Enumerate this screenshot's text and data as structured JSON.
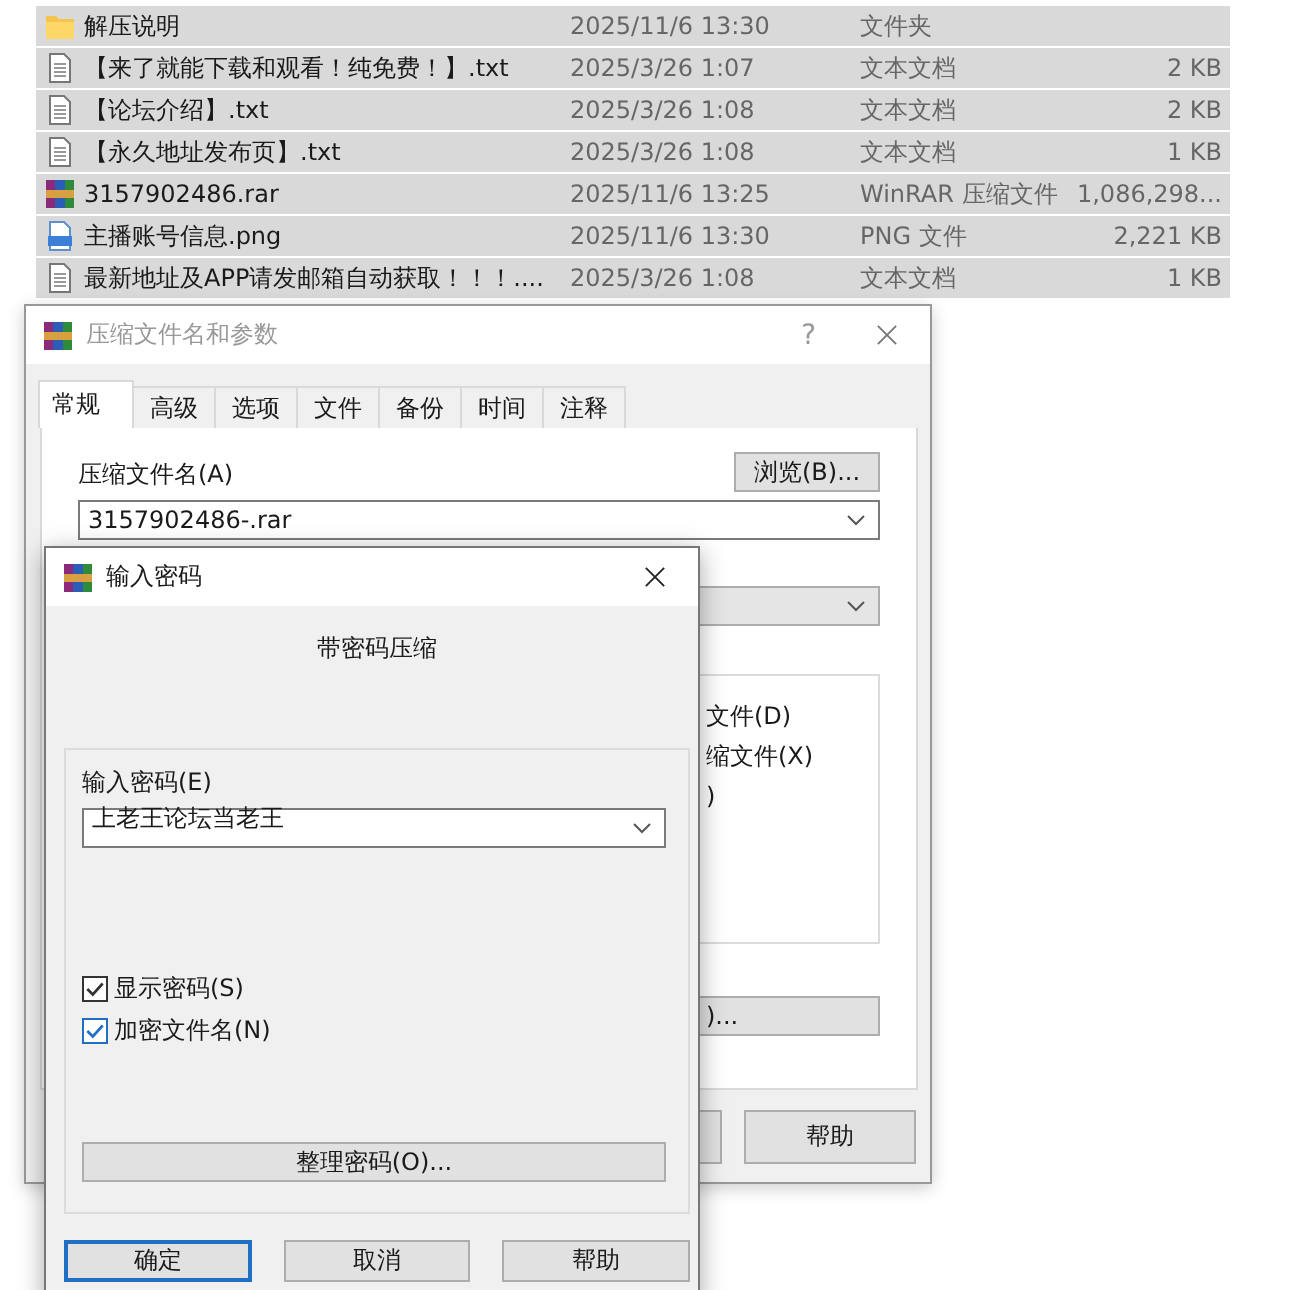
{
  "files": [
    {
      "name": "解压说明",
      "date": "2025/11/6 13:30",
      "type": "文件夹",
      "kind": "folder",
      "selected": true
    },
    {
      "name": "【来了就能下载和观看！纯免费！】.txt",
      "date": "2025/3/26 1:07",
      "type": "文本文档",
      "size": "2 KB",
      "kind": "text",
      "selected": true
    },
    {
      "name": "【论坛介绍】.txt",
      "date": "2025/3/26 1:08",
      "type": "文本文档",
      "size": "2 KB",
      "kind": "text",
      "selected": true
    },
    {
      "name": "【永久地址发布页】.txt",
      "date": "2025/3/26 1:08",
      "type": "文本文档",
      "size": "1 KB",
      "kind": "text",
      "selected": true
    },
    {
      "name": "3157902486.rar",
      "date": "2025/11/6 13:25",
      "type": "WinRAR 压缩文件",
      "size": "1,086,298...",
      "kind": "rar",
      "selected": true
    },
    {
      "name": "主播账号信息.png",
      "date": "2025/11/6 13:30",
      "type": "PNG 文件",
      "size": "2,221 KB",
      "kind": "png",
      "selected": true
    },
    {
      "name": "最新地址及APP请发邮箱自动获取！！！....",
      "date": "2025/3/26 1:08",
      "type": "文本文档",
      "size": "1 KB",
      "kind": "text",
      "selected": true
    }
  ],
  "archive_dialog": {
    "title": "压缩文件名和参数",
    "help_glyph": "?",
    "tabs": [
      {
        "label": "常规",
        "selected": true
      },
      {
        "label": "高级",
        "selected": false
      },
      {
        "label": "选项",
        "selected": false
      },
      {
        "label": "文件",
        "selected": false
      },
      {
        "label": "备份",
        "selected": false
      },
      {
        "label": "时间",
        "selected": false
      },
      {
        "label": "注释",
        "selected": false
      }
    ],
    "archive_name_label": "压缩文件名(A)",
    "browse_button": "浏览(B)...",
    "archive_name": "3157902486-.rar",
    "option_fragments": [
      "文件(D)",
      "缩文件(X)",
      ")"
    ],
    "button_fragment": ")...",
    "help_button": "帮助"
  },
  "password_dialog": {
    "title": "输入密码",
    "heading": "带密码压缩",
    "password_label": "输入密码(E)",
    "password": "上老王论坛当老王",
    "checkboxes": [
      {
        "label": "显示密码(S)",
        "checked": true,
        "focused": false
      },
      {
        "label": "加密文件名(N)",
        "checked": true,
        "focused": true
      }
    ],
    "organize_button": "整理密码(O)...",
    "buttons": [
      {
        "label": "确定",
        "focused": true
      },
      {
        "label": "取消",
        "focused": false
      },
      {
        "label": "帮助",
        "focused": false
      }
    ]
  }
}
